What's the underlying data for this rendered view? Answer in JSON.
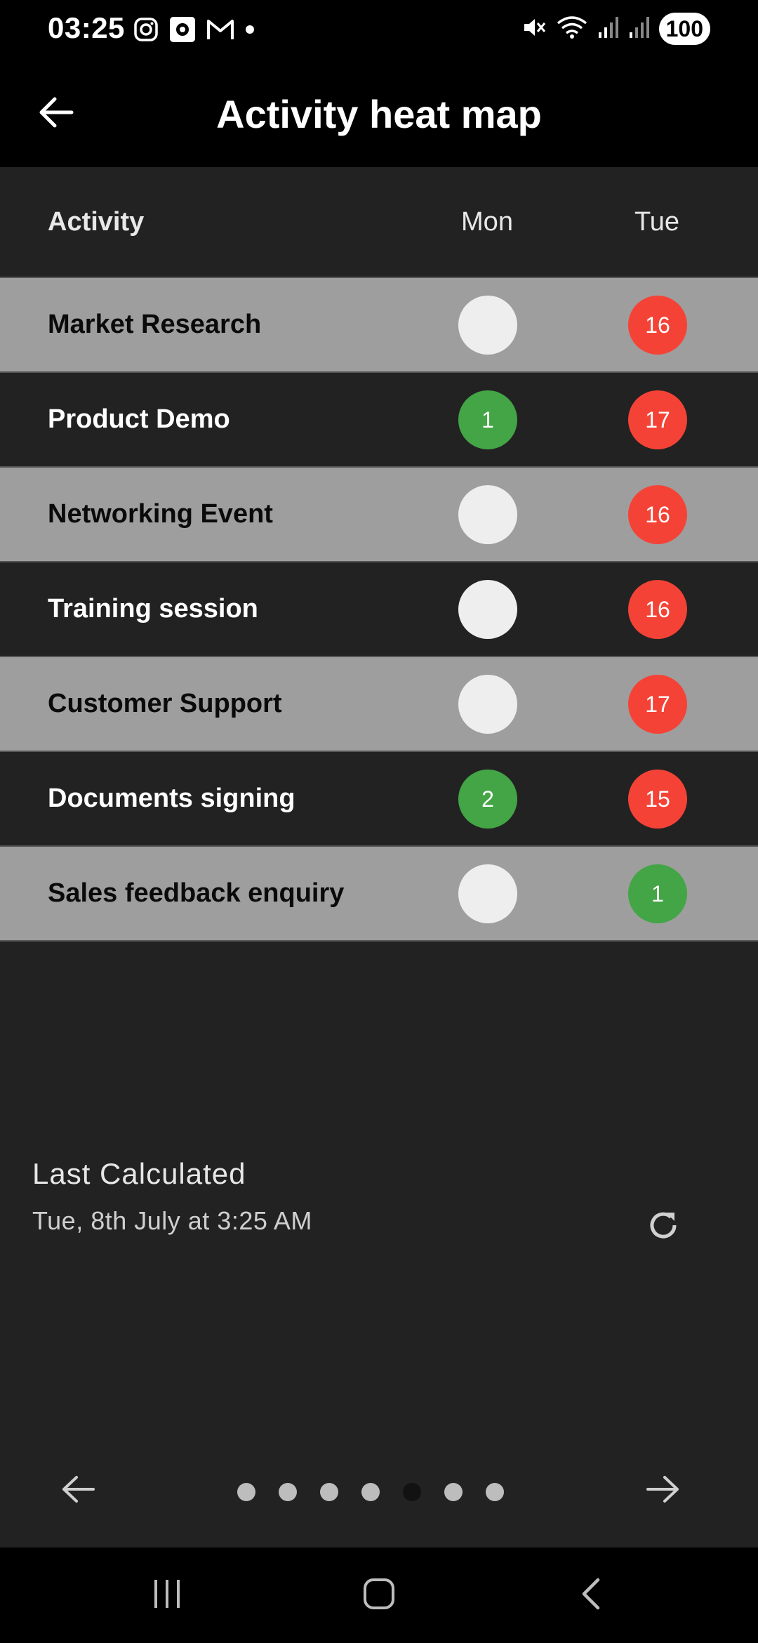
{
  "status_bar": {
    "time": "03:25",
    "notification_icons": [
      "instagram-icon",
      "camera-icon",
      "gmail-icon",
      "dot-icon"
    ],
    "right_icons": [
      "mute-icon",
      "wifi-icon",
      "signal-icon",
      "signal-icon"
    ],
    "battery": "100"
  },
  "app_bar": {
    "title": "Activity heat map",
    "back_icon": "arrow-left-icon"
  },
  "table": {
    "headers": {
      "activity": "Activity",
      "mon": "Mon",
      "tue": "Tue"
    },
    "rows": [
      {
        "activity": "Market Research",
        "mon": "",
        "mon_status": "empty",
        "tue": "16",
        "tue_status": "red"
      },
      {
        "activity": "Product Demo",
        "mon": "1",
        "mon_status": "green",
        "tue": "17",
        "tue_status": "red"
      },
      {
        "activity": "Networking Event",
        "mon": "",
        "mon_status": "empty",
        "tue": "16",
        "tue_status": "red"
      },
      {
        "activity": "Training session",
        "mon": "",
        "mon_status": "empty",
        "tue": "16",
        "tue_status": "red"
      },
      {
        "activity": "Customer Support",
        "mon": "",
        "mon_status": "empty",
        "tue": "17",
        "tue_status": "red"
      },
      {
        "activity": "Documents signing",
        "mon": "2",
        "mon_status": "green",
        "tue": "15",
        "tue_status": "red"
      },
      {
        "activity": "Sales feedback enquiry",
        "mon": "",
        "mon_status": "empty",
        "tue": "1",
        "tue_status": "green"
      }
    ]
  },
  "colors": {
    "green": "#43a545",
    "red": "#f44336",
    "empty": "#eeeeee",
    "row_light": "#9e9e9e",
    "row_dark": "#222222"
  },
  "footer": {
    "last_calculated_label": "Last Calculated",
    "last_calculated_time": "Tue, 8th July at 3:25 AM",
    "refresh_icon": "refresh-icon"
  },
  "pager": {
    "page_count": 7,
    "active_page": 5
  },
  "system_nav": [
    "recents-icon",
    "home-icon",
    "back-icon"
  ]
}
